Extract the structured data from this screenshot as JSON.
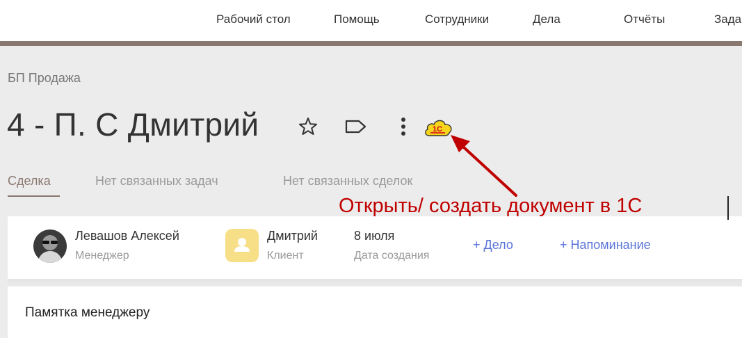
{
  "topnav": {
    "items": [
      {
        "label": "Рабочий стол"
      },
      {
        "label": "Помощь"
      },
      {
        "label": "Сотрудники"
      },
      {
        "label": "Дела"
      },
      {
        "label": "Отчёты"
      },
      {
        "label": "Зада"
      }
    ]
  },
  "header": {
    "breadcrumb": "БП Продажа",
    "title": "4 - П. С Дмитрий",
    "icons": {
      "star": "star-icon",
      "tag": "tag-icon",
      "more": "more-vertical-icon",
      "onec": "1c-cloud-icon"
    },
    "onec_logo_text": "1С"
  },
  "tabs": [
    {
      "label": "Сделка",
      "active": true
    },
    {
      "label": "Нет связанных задач",
      "active": false
    },
    {
      "label": "Нет связанных сделок",
      "active": false
    }
  ],
  "annotation": {
    "text": "Открыть/ создать  документ в 1С",
    "color": "#c00000"
  },
  "info": {
    "manager": {
      "name": "Левашов Алексей",
      "role": "Менеджер"
    },
    "client": {
      "name": "Дмитрий",
      "role": "Клиент"
    },
    "created": {
      "value": "8 июля",
      "label": "Дата создания"
    },
    "actions": {
      "task": "+ Дело",
      "reminder": "+ Напоминание"
    }
  },
  "memo": {
    "title": "Памятка менеджеру"
  },
  "colors": {
    "accent": "#8a7770",
    "link": "#5a74d8",
    "annotation": "#c00000",
    "client_avatar_bg": "#f7df87",
    "onec_yellow": "#f7d51d",
    "onec_red": "#d0021b"
  }
}
